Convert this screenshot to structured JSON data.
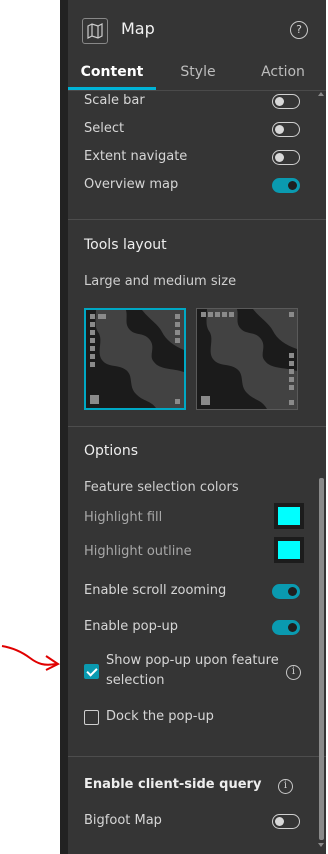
{
  "header": {
    "title": "Map",
    "icon": "map-icon",
    "help_icon": "help-icon",
    "help_glyph": "?"
  },
  "tabs": [
    {
      "label": "Content",
      "active": true
    },
    {
      "label": "Style",
      "active": false
    },
    {
      "label": "Action",
      "active": false
    }
  ],
  "tools": [
    {
      "label": "Scale bar",
      "enabled": false
    },
    {
      "label": "Select",
      "enabled": false
    },
    {
      "label": "Extent navigate",
      "enabled": false
    },
    {
      "label": "Overview map",
      "enabled": true
    }
  ],
  "tools_layout": {
    "title": "Tools layout",
    "subtitle": "Large and medium size"
  },
  "options": {
    "title": "Options",
    "feature_selection_colors": "Feature selection colors",
    "highlight_fill": {
      "label": "Highlight fill",
      "color": "#00ffff"
    },
    "highlight_outline": {
      "label": "Highlight outline",
      "color": "#00ffff"
    },
    "enable_scroll_zooming": {
      "label": "Enable scroll zooming",
      "enabled": true
    },
    "enable_popup": {
      "label": "Enable pop-up",
      "enabled": true
    },
    "show_popup_on_selection": {
      "label_line1": "Show pop-up upon feature",
      "label_line2": "selection",
      "checked": true
    },
    "dock_popup": {
      "label": "Dock the pop-up",
      "checked": false
    }
  },
  "client_query": {
    "title": "Enable client-side query",
    "info_glyph": "i",
    "items": [
      {
        "label": "Bigfoot Map",
        "enabled": false
      }
    ]
  },
  "colors": {
    "accent": "#00b3d6",
    "toggle_on": "#0a9ab0",
    "panel_bg": "#353535",
    "annotation": "#e00000"
  }
}
